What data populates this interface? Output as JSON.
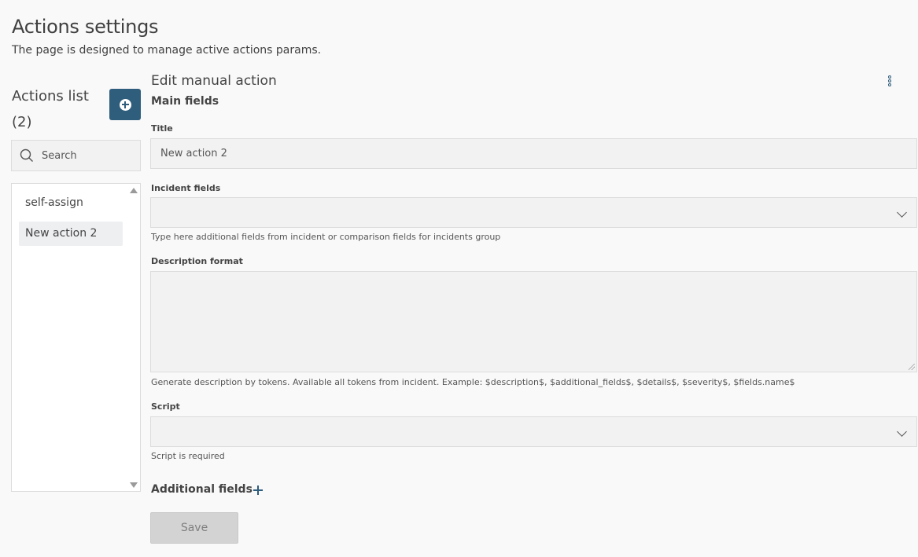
{
  "header": {
    "title": "Actions settings",
    "subtitle": "The page is designed to manage active actions params."
  },
  "sidebar": {
    "title": "Actions list",
    "count": "(2)",
    "search_placeholder": "Search",
    "items": [
      {
        "label": "self-assign",
        "selected": false
      },
      {
        "label": "New action 2",
        "selected": true
      }
    ]
  },
  "editor": {
    "title": "Edit manual action",
    "main_section": "Main fields",
    "title_field": {
      "label": "Title",
      "value": "New action 2"
    },
    "incident_fields": {
      "label": "Incident fields",
      "value": "",
      "help": "Type here additional fields from incident or comparison fields for incidents group"
    },
    "description_format": {
      "label": "Description format",
      "value": "",
      "help": "Generate description by tokens. Available all tokens from incident. Example: $description$, $additional_fields$, $details$, $severity$, $fields.name$"
    },
    "script": {
      "label": "Script",
      "value": "",
      "help": "Script is required"
    },
    "additional_section": "Additional fields",
    "save_label": "Save"
  },
  "colors": {
    "accent": "#2f5d7c",
    "field_bg": "#f2f2f3",
    "page_bg": "#f9f9f9",
    "disabled_button": "#d3d3d3"
  },
  "icons": [
    "plus-circle-icon",
    "search-icon",
    "more-vertical-icon",
    "chevron-down-icon",
    "plus-icon",
    "scroll-up-icon",
    "scroll-down-icon"
  ]
}
